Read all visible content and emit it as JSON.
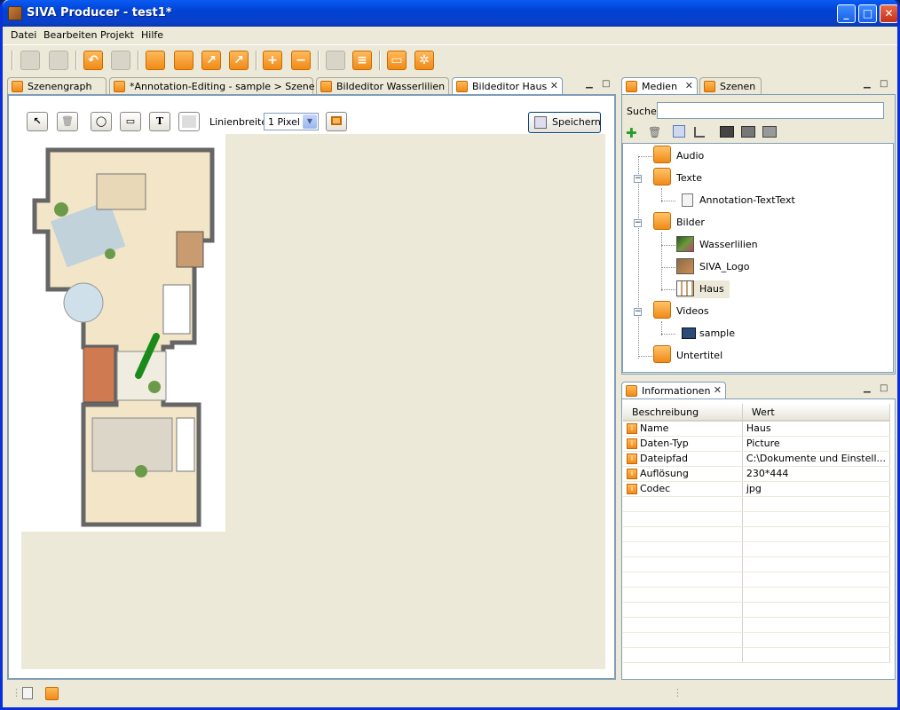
{
  "window": {
    "title": "SIVA Producer - test1*",
    "minimize": "_",
    "maximize": "□",
    "close": "✕"
  },
  "menu": [
    "Datei",
    "Bearbeiten",
    "Projekt",
    "Hilfe"
  ],
  "editor_tabs": [
    {
      "label": "Szenengraph"
    },
    {
      "label": "*Annotation-Editing - sample > Szene"
    },
    {
      "label": "Bildeditor Wasserlilien"
    },
    {
      "label": "Bildeditor Haus",
      "close": "✕"
    }
  ],
  "image_editor": {
    "tools": {
      "select": "↖",
      "delete": "🗑",
      "ellipse": "◯",
      "rectangle": "▭",
      "text": "T"
    },
    "line_width_label": "Linienbreite",
    "line_width_value": "1 Pixel",
    "save_label": "Speichern",
    "color_accent": "#1a8a1a"
  },
  "media_panel": {
    "tabs": [
      {
        "label": "Medien",
        "close": "✕"
      },
      {
        "label": "Szenen"
      }
    ],
    "search_label": "Suche",
    "search_value": "",
    "tree": {
      "audio": "Audio",
      "texte": "Texte",
      "annotation": "Annotation-TextText",
      "bilder": "Bilder",
      "wasserlilien": "Wasserlilien",
      "siva_logo": "SIVA_Logo",
      "haus": "Haus",
      "videos": "Videos",
      "sample": "sample",
      "untertitel": "Untertitel"
    }
  },
  "info_panel": {
    "title": "Informationen",
    "close": "✕",
    "col_desc": "Beschreibung",
    "col_value": "Wert",
    "rows": [
      {
        "key": "Name",
        "value": "Haus"
      },
      {
        "key": "Daten-Typ",
        "value": "Picture"
      },
      {
        "key": "Dateipfad",
        "value": "C:\\Dokumente und Einstell..."
      },
      {
        "key": "Auflösung",
        "value": "230*444"
      },
      {
        "key": "Codec",
        "value": "jpg"
      }
    ]
  },
  "colors": {
    "titlebar": "#0a4fe0",
    "accent_orange": "#f08a18",
    "panel_border": "#7f9db9"
  }
}
